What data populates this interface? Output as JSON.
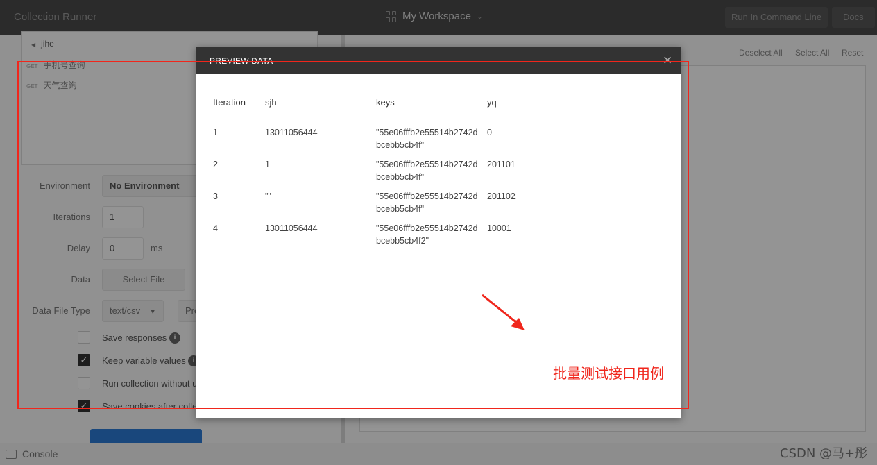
{
  "app": {
    "title": "Collection Runner",
    "workspace": "My Workspace",
    "run_cmd_label": "Run In Command Line",
    "docs_label": "Docs"
  },
  "collection": {
    "name": "jihe",
    "requests": [
      {
        "method": "GET",
        "name": "手机号查询"
      },
      {
        "method": "GET",
        "name": "天气查询"
      }
    ]
  },
  "settings": {
    "environment_label": "Environment",
    "environment_value": "No Environment",
    "iterations_label": "Iterations",
    "iterations_value": "1",
    "delay_label": "Delay",
    "delay_value": "0",
    "delay_unit": "ms",
    "data_label": "Data",
    "select_file_label": "Select File",
    "data_file_type_label": "Data File Type",
    "data_file_type_value": "text/csv",
    "preview_partial": "Pre",
    "checkboxes": [
      {
        "label": "Save responses",
        "checked": false
      },
      {
        "label": "Keep variable values",
        "checked": true
      },
      {
        "label": "Run collection without u",
        "checked": false
      },
      {
        "label": "Save cookies after colle",
        "checked": true
      }
    ]
  },
  "right_panel": {
    "deselect_all": "Deselect All",
    "select_all": "Select All",
    "reset": "Reset"
  },
  "bottom": {
    "console_label": "Console"
  },
  "modal": {
    "title": "PREVIEW DATA",
    "close_glyph": "×",
    "columns": [
      "Iteration",
      "sjh",
      "keys",
      "yq"
    ],
    "rows": [
      {
        "iteration": "1",
        "sjh": "13011056444",
        "keys_line1": "\"55e06fffb2e55514b2742d",
        "keys_line2": "bcebb5cb4f\"",
        "yq": "0"
      },
      {
        "iteration": "2",
        "sjh": "1",
        "keys_line1": "\"55e06fffb2e55514b2742d",
        "keys_line2": "bcebb5cb4f\"",
        "yq": "201101"
      },
      {
        "iteration": "3",
        "sjh": "\"\"",
        "keys_line1": "\"55e06fffb2e55514b2742d",
        "keys_line2": "bcebb5cb4f\"",
        "yq": "201102"
      },
      {
        "iteration": "4",
        "sjh": "13011056444",
        "keys_line1": "\"55e06fffb2e55514b2742d",
        "keys_line2": "bcebb5cb4f2\"",
        "yq": "10001"
      }
    ]
  },
  "annotation": {
    "note": "批量测试接口用例",
    "color": "#f0261c"
  },
  "watermark": "CSDN @马+彤"
}
